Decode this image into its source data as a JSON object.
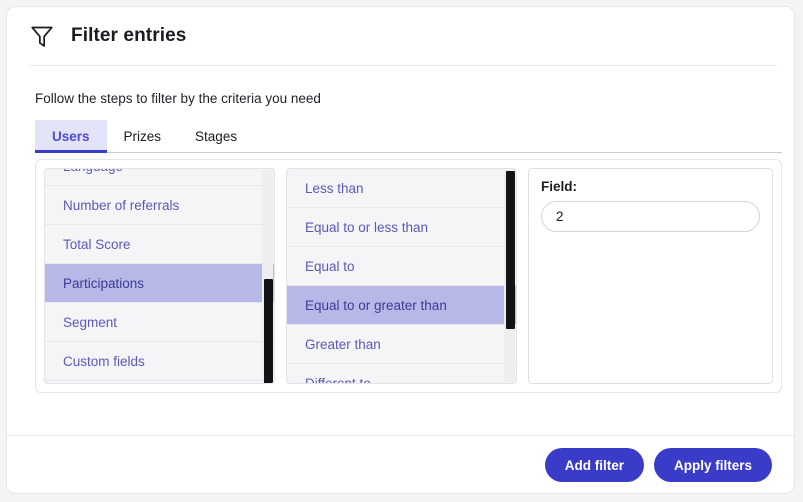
{
  "header": {
    "title": "Filter entries",
    "icon": "funnel-icon"
  },
  "subtitle": "Follow the steps to filter by the criteria you need",
  "tabs": [
    {
      "label": "Users",
      "active": true
    },
    {
      "label": "Prizes",
      "active": false
    },
    {
      "label": "Stages",
      "active": false
    }
  ],
  "columns": {
    "fields": {
      "items": [
        {
          "label": "Language",
          "selected": false,
          "partial": true
        },
        {
          "label": "Number of referrals",
          "selected": false
        },
        {
          "label": "Total Score",
          "selected": false
        },
        {
          "label": "Participations",
          "selected": true
        },
        {
          "label": "Segment",
          "selected": false
        },
        {
          "label": "Custom fields",
          "selected": false
        }
      ],
      "scroll": {
        "thumb_top_pct": 48,
        "thumb_height_pct": 50
      }
    },
    "operators": {
      "items": [
        {
          "label": "Less than",
          "selected": false
        },
        {
          "label": "Equal to or less than",
          "selected": false
        },
        {
          "label": "Equal to",
          "selected": false
        },
        {
          "label": "Equal to or greater than",
          "selected": true
        },
        {
          "label": "Greater than",
          "selected": false
        },
        {
          "label": "Different to",
          "selected": false,
          "partial": true
        }
      ],
      "scroll": {
        "thumb_top_pct": 0,
        "thumb_height_pct": 72
      }
    },
    "value": {
      "label": "Field:",
      "input_value": "2",
      "input_placeholder": ""
    }
  },
  "footer": {
    "add_filter_label": "Add filter",
    "apply_filters_label": "Apply filters"
  },
  "colors": {
    "accent": "#3b3bc9",
    "selection": "#b7b7e8",
    "list_text": "#5a5ab4",
    "tab_active_bg": "#e3e3f8",
    "panel_bg": "#f5f5f7",
    "scroll_thumb": "#131316"
  }
}
